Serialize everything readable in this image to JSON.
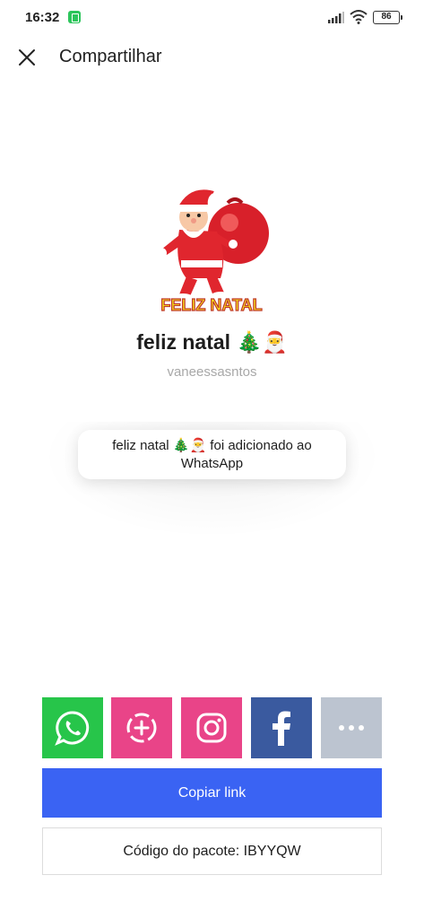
{
  "status_bar": {
    "time": "16:32",
    "battery": "86"
  },
  "header": {
    "title": "Compartilhar"
  },
  "pack": {
    "sticker_text": "FELIZ NATAL",
    "title": "feliz natal 🎄🎅",
    "author": "vaneessasntos"
  },
  "toast": {
    "line1": "feliz natal 🎄🎅 foi adicionado ao",
    "line2": "WhatsApp"
  },
  "share": {
    "buttons": [
      {
        "name": "whatsapp",
        "color": "#27c54a",
        "icon": "whatsapp-icon"
      },
      {
        "name": "whatsapp-status",
        "color": "#e94488",
        "icon": "status-add-icon"
      },
      {
        "name": "instagram",
        "color": "#e94488",
        "icon": "instagram-icon"
      },
      {
        "name": "facebook",
        "color": "#3a5a9f",
        "icon": "facebook-icon"
      },
      {
        "name": "more",
        "color": "#bcc4d0",
        "icon": "more-dots-icon"
      }
    ],
    "copy_link_label": "Copiar link",
    "code_label": "Código do pacote: IBYYQW"
  },
  "colors": {
    "accent": "#3a63f3"
  }
}
